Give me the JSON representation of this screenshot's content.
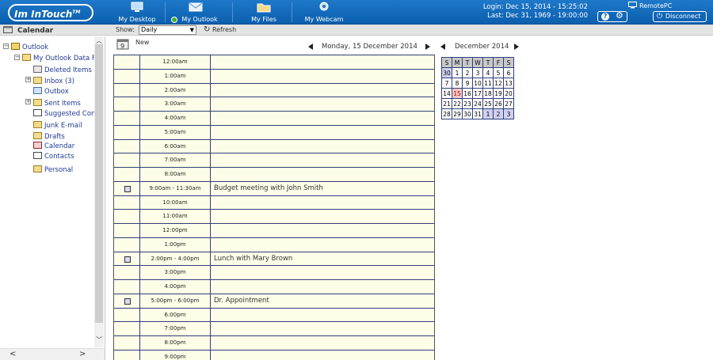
{
  "topbar": {
    "logo": "Im InTouch",
    "nav": [
      {
        "label": "My Desktop",
        "icon": "desktop-icon"
      },
      {
        "label": "My Outlook",
        "icon": "envelope-icon"
      },
      {
        "label": "My Files",
        "icon": "folder-icon"
      },
      {
        "label": "My Webcam",
        "icon": "webcam-icon"
      }
    ],
    "login": "Login: Dec 15, 2014 - 15:25:02",
    "last": "Last: Dec 31, 1969 - 19:00:00",
    "computer": "RemotePC",
    "disconnect": "Disconnect"
  },
  "subbar": {
    "title": "Calendar",
    "show_label": "Show:",
    "show_value": "Daily",
    "refresh": "Refresh"
  },
  "sidebar": {
    "items": [
      {
        "label": "Outlook",
        "icon": "outlook-icon"
      },
      {
        "label": "My Outlook Data Fi",
        "icon": "folder-icon"
      },
      {
        "label": "Deleted Items",
        "icon": "trash-icon"
      },
      {
        "label": "Inbox (3)",
        "icon": "inbox-icon"
      },
      {
        "label": "Outbox",
        "icon": "outbox-icon"
      },
      {
        "label": "Sent Items",
        "icon": "sent-icon"
      },
      {
        "label": "Suggested Cont",
        "icon": "contacts-icon"
      },
      {
        "label": "Junk E-mail",
        "icon": "junk-icon"
      },
      {
        "label": "Drafts",
        "icon": "drafts-icon"
      },
      {
        "label": "Calendar",
        "icon": "calendar-icon"
      },
      {
        "label": "Contacts",
        "icon": "contacts-icon"
      },
      {
        "label": "Personal",
        "icon": "folder-icon"
      }
    ]
  },
  "calendar": {
    "new_label": "New",
    "day_header": "Monday, 15  December  2014",
    "month_header": "December  2014",
    "rows": [
      {
        "time": "12:00am",
        "event": "",
        "appt": false
      },
      {
        "time": "1:00am",
        "event": "",
        "appt": false
      },
      {
        "time": "2:00am",
        "event": "",
        "appt": false
      },
      {
        "time": "3:00am",
        "event": "",
        "appt": false
      },
      {
        "time": "4:00am",
        "event": "",
        "appt": false
      },
      {
        "time": "5:00am",
        "event": "",
        "appt": false
      },
      {
        "time": "6:00am",
        "event": "",
        "appt": false
      },
      {
        "time": "7:00am",
        "event": "",
        "appt": false
      },
      {
        "time": "8:00am",
        "event": "",
        "appt": false
      },
      {
        "time": "9:00am - 11:30am",
        "event": "Budget meeting with John Smith",
        "appt": true
      },
      {
        "time": "10:00am",
        "event": "",
        "appt": false
      },
      {
        "time": "11:00am",
        "event": "",
        "appt": false
      },
      {
        "time": "12:00pm",
        "event": "",
        "appt": false
      },
      {
        "time": "1:00pm",
        "event": "",
        "appt": false
      },
      {
        "time": "2:00pm - 4:00pm",
        "event": "Lunch with Mary Brown",
        "appt": true
      },
      {
        "time": "3:00pm",
        "event": "",
        "appt": false
      },
      {
        "time": "4:00pm",
        "event": "",
        "appt": false
      },
      {
        "time": "5:00pm - 6:00pm",
        "event": "Dr. Appointment",
        "appt": true
      },
      {
        "time": "6:00pm",
        "event": "",
        "appt": false
      },
      {
        "time": "7:00pm",
        "event": "",
        "appt": false
      },
      {
        "time": "8:00pm",
        "event": "",
        "appt": false
      },
      {
        "time": "9:00pm",
        "event": "",
        "appt": false
      }
    ],
    "mini": {
      "weekdays": [
        "S",
        "M",
        "T",
        "W",
        "T",
        "F",
        "S"
      ],
      "weeks": [
        [
          {
            "d": "30",
            "o": true
          },
          {
            "d": "1"
          },
          {
            "d": "2"
          },
          {
            "d": "3"
          },
          {
            "d": "4"
          },
          {
            "d": "5"
          },
          {
            "d": "6"
          }
        ],
        [
          {
            "d": "7"
          },
          {
            "d": "8"
          },
          {
            "d": "9"
          },
          {
            "d": "10"
          },
          {
            "d": "11"
          },
          {
            "d": "12"
          },
          {
            "d": "13"
          }
        ],
        [
          {
            "d": "14"
          },
          {
            "d": "15",
            "t": true
          },
          {
            "d": "16"
          },
          {
            "d": "17"
          },
          {
            "d": "18"
          },
          {
            "d": "19"
          },
          {
            "d": "20"
          }
        ],
        [
          {
            "d": "21"
          },
          {
            "d": "22"
          },
          {
            "d": "23"
          },
          {
            "d": "24"
          },
          {
            "d": "25"
          },
          {
            "d": "26"
          },
          {
            "d": "27"
          }
        ],
        [
          {
            "d": "28"
          },
          {
            "d": "29"
          },
          {
            "d": "30"
          },
          {
            "d": "31"
          },
          {
            "d": "1",
            "o": true
          },
          {
            "d": "2",
            "o": true
          },
          {
            "d": "3",
            "o": true
          }
        ]
      ]
    }
  }
}
